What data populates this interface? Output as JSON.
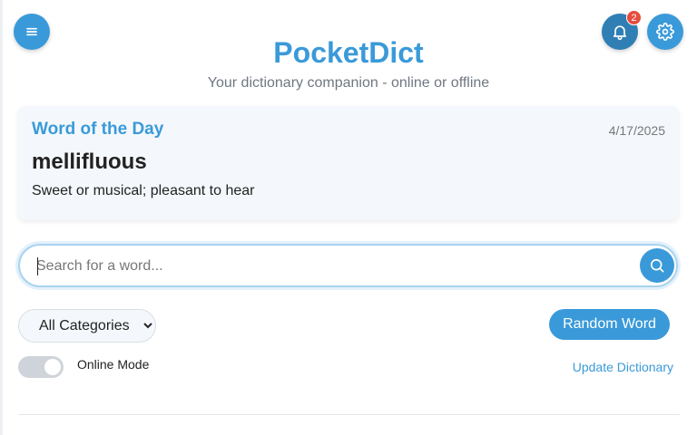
{
  "header": {
    "title": "PocketDict",
    "subtitle": "Your dictionary companion - online or offline",
    "notification_count": "2",
    "icons": {
      "menu": "menu-icon",
      "notifications": "bell-icon",
      "settings": "gear-icon"
    }
  },
  "word_of_the_day": {
    "heading": "Word of the Day",
    "date": "4/17/2025",
    "word": "mellifluous",
    "definition": "Sweet or musical; pleasant to hear"
  },
  "search": {
    "placeholder": "Search for a word...",
    "value": "",
    "button_icon": "search-icon"
  },
  "controls": {
    "category_options": [
      "All Categories"
    ],
    "category_selected": "All Categories",
    "random_label": "Random Word",
    "online_mode_label": "Online Mode",
    "online_mode_on": false,
    "update_label": "Update Dictionary"
  },
  "colors": {
    "accent": "#3a9ad9",
    "accent_dark": "#2f7fb5",
    "badge": "#e74c3c",
    "card_bg": "#f4f8fc"
  }
}
